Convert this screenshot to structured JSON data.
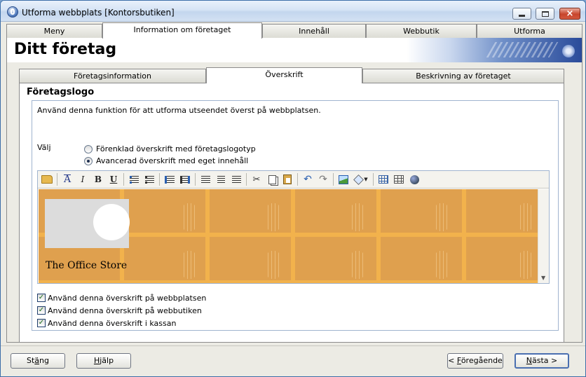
{
  "window": {
    "title": "Utforma webbplats [Kontorsbutiken]"
  },
  "main_tabs": [
    {
      "label": "Meny"
    },
    {
      "label": "Information om företaget"
    },
    {
      "label": "Innehåll"
    },
    {
      "label": "Webbutik"
    },
    {
      "label": "Utforma"
    }
  ],
  "header": {
    "title": "Ditt företag"
  },
  "sub_tabs": [
    {
      "label": "Företagsinformation"
    },
    {
      "label": "Överskrift"
    },
    {
      "label": "Beskrivning av företaget"
    }
  ],
  "section": {
    "title": "Företagslogo",
    "description": "Använd denna funktion för att utforma utseendet överst på webbplatsen.",
    "choose_label": "Välj",
    "radio_options": [
      {
        "label": "Förenklad överskrift med företagslogotyp",
        "selected": false
      },
      {
        "label": "Avancerad överskrift med eget innehåll",
        "selected": true
      }
    ]
  },
  "editor": {
    "preview_text": "The Office Store",
    "colors": {
      "background": "#dfa04e",
      "grid": "#f2b24c",
      "logo_block": "#dcdcdc"
    }
  },
  "checkboxes": [
    {
      "label": "Använd denna överskrift på webbplatsen",
      "checked": true
    },
    {
      "label": "Använd denna överskrift på webbutiken",
      "checked": true
    },
    {
      "label": "Använd denna överskrift i kassan",
      "checked": true
    }
  ],
  "footer": {
    "close": {
      "pre": "St",
      "key": "ä",
      "post": "ng"
    },
    "help": {
      "pre": "",
      "key": "H",
      "post": "jälp"
    },
    "prev": {
      "pre": "< ",
      "key": "F",
      "post": "öregående"
    },
    "next": {
      "pre": "",
      "key": "N",
      "post": "ästa >"
    }
  }
}
